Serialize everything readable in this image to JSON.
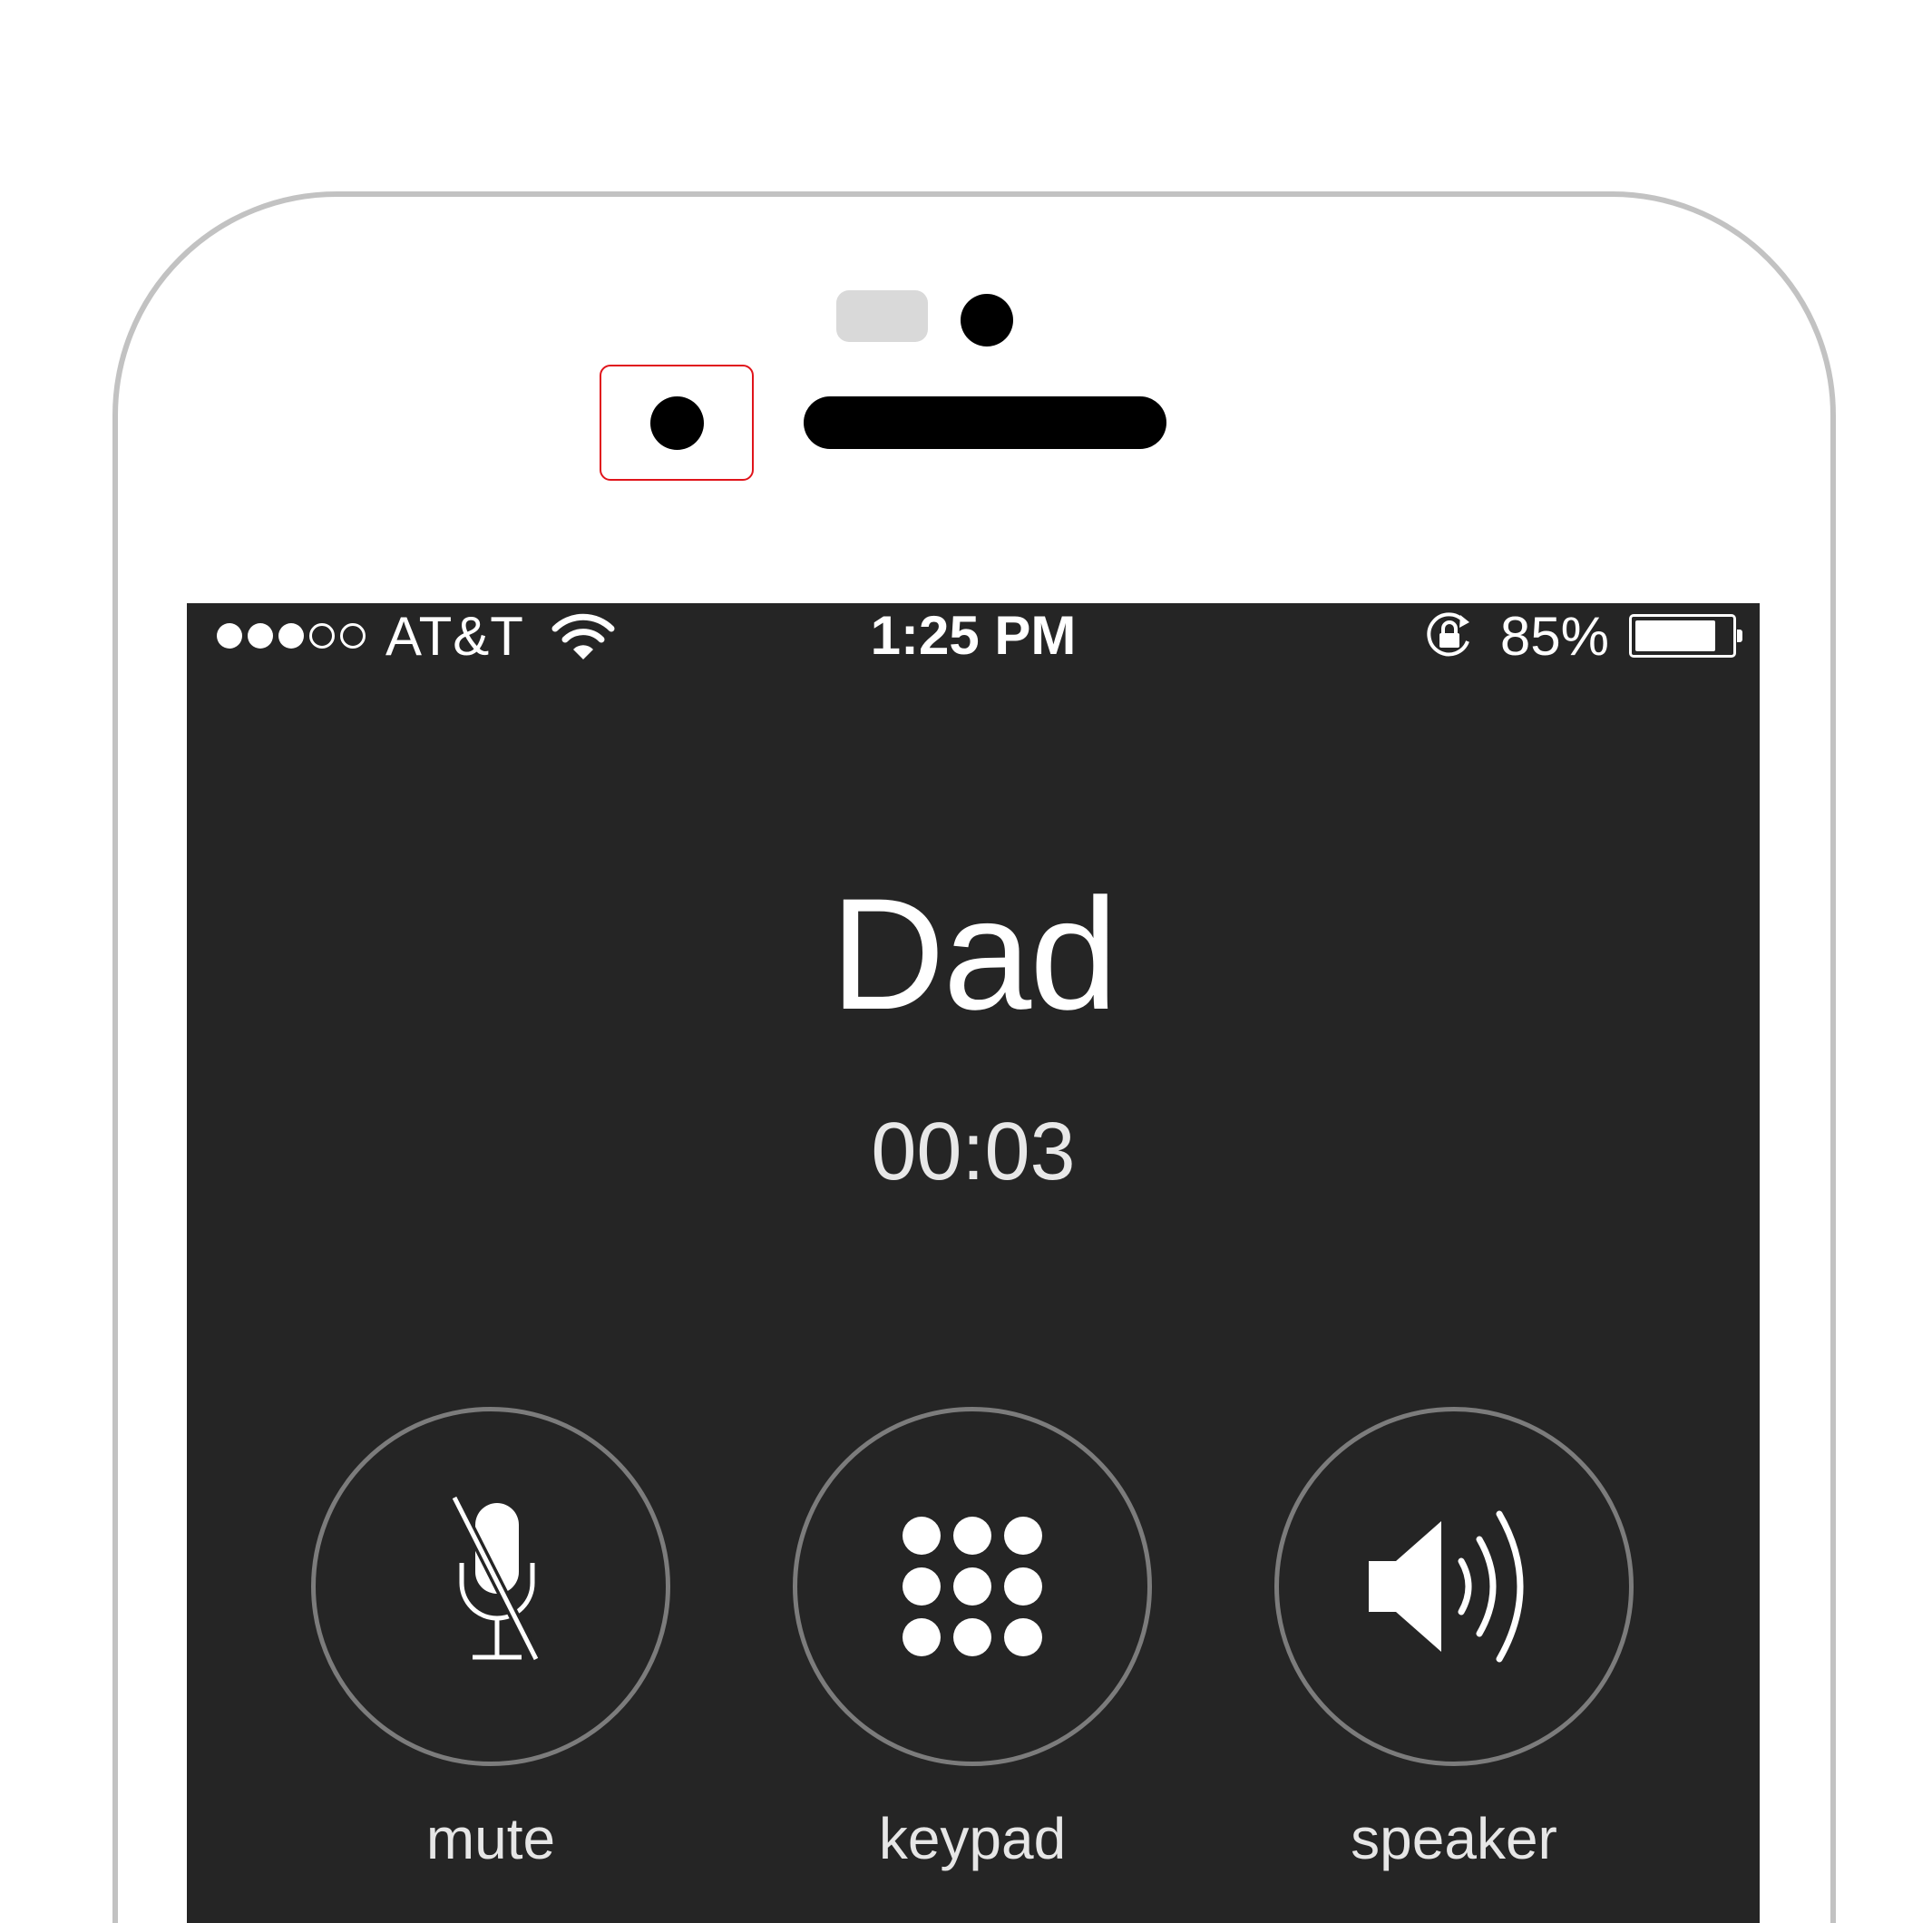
{
  "status_bar": {
    "signal": {
      "filled": 3,
      "total": 5
    },
    "carrier": "AT&T",
    "time": "1:25 PM",
    "battery_percent": "85%",
    "battery_level": 0.85,
    "icons": [
      "wifi-icon",
      "orientation-lock-icon",
      "battery-icon"
    ]
  },
  "call": {
    "caller_name": "Dad",
    "duration": "00:03"
  },
  "controls": {
    "mute_label": "mute",
    "keypad_label": "keypad",
    "speaker_label": "speaker"
  },
  "colors": {
    "screen_background": "#252525",
    "button_ring": "#7c7c7c",
    "text": "#ffffff",
    "highlight": "#e0141b",
    "phone_outline": "#c2c2c2"
  }
}
